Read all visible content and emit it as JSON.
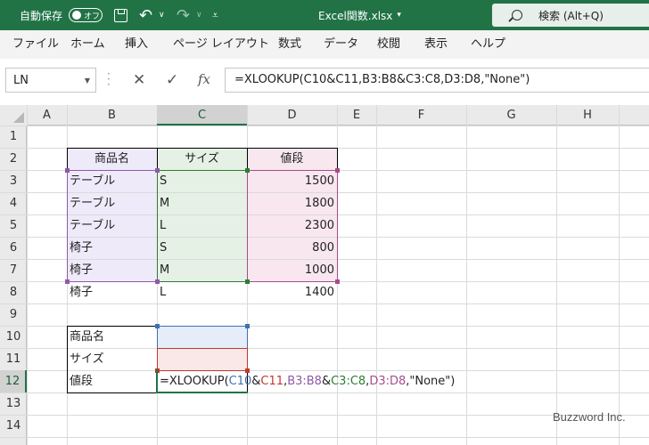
{
  "titlebar": {
    "autosave_label": "自動保存",
    "autosave_state": "オフ",
    "file_name": "Excel関数.xlsx",
    "search_text": "検索 (Alt+Q)"
  },
  "menu": [
    "ファイル",
    "ホーム",
    "挿入",
    "ページ レイアウト",
    "数式",
    "データ",
    "校閲",
    "表示",
    "ヘルプ"
  ],
  "namebox": "LN",
  "formula": "=XLOOKUP(C10&C11,B3:B8&C3:C8,D3:D8,\"None\")",
  "columns": [
    "A",
    "B",
    "C",
    "D",
    "E",
    "F",
    "G",
    "H"
  ],
  "rows": [
    "1",
    "2",
    "3",
    "4",
    "5",
    "6",
    "7",
    "8",
    "9",
    "10",
    "11",
    "12",
    "13",
    "14"
  ],
  "table": {
    "headers": [
      "商品名",
      "サイズ",
      "値段"
    ],
    "rows": [
      [
        "テーブル",
        "S",
        "1500"
      ],
      [
        "テーブル",
        "M",
        "1800"
      ],
      [
        "テーブル",
        "L",
        "2300"
      ],
      [
        "椅子",
        "S",
        "800"
      ],
      [
        "椅子",
        "M",
        "1000"
      ],
      [
        "椅子",
        "L",
        "1400"
      ]
    ]
  },
  "lookup": {
    "labels": [
      "商品名",
      "サイズ",
      "値段"
    ]
  },
  "cell_formula": {
    "p1": "=XLOOKUP(",
    "ref1": "C10",
    "amp1": "&",
    "ref2": "C11",
    "comma1": ",",
    "ref3": "B3:B8",
    "amp2": "&",
    "ref4": "C3:C8",
    "comma2": ",",
    "ref5": "D3:D8",
    "tail": ",\"None\")"
  },
  "colors": {
    "brand": "#217346",
    "ref_blue": "#3f6fb5",
    "ref_red": "#c0392b",
    "ref_purple": "#8e5aa8",
    "ref_green": "#2e7d32",
    "ref_magenta": "#a54d8c"
  },
  "watermark": "Buzzword Inc."
}
